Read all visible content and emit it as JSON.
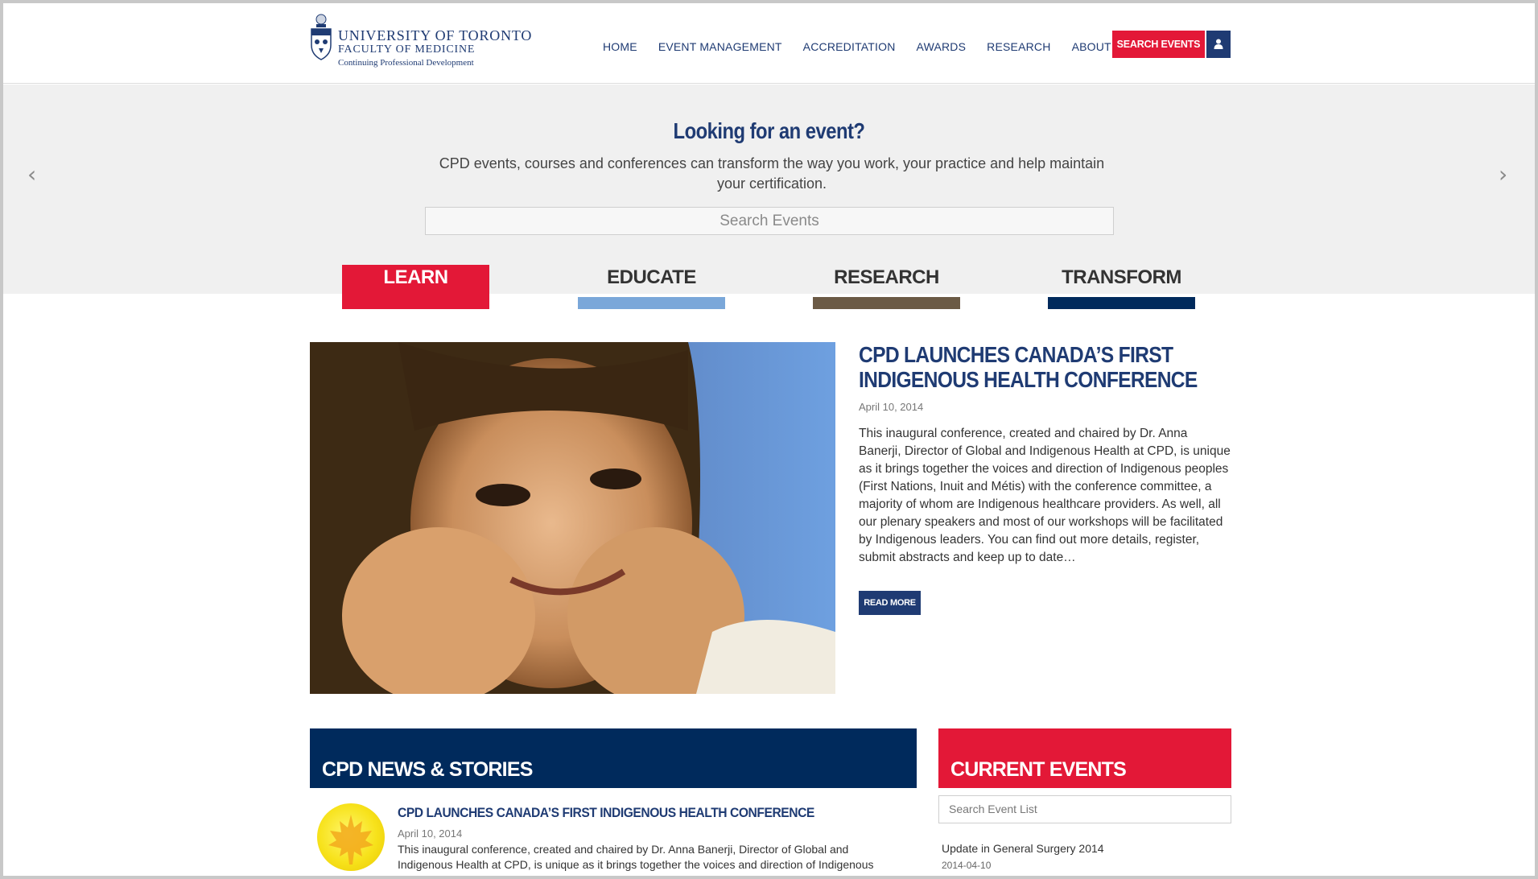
{
  "header": {
    "logo": {
      "line1": "UNIVERSITY OF TORONTO",
      "line2": "FACULTY OF MEDICINE",
      "line3": "Continuing Professional Development"
    },
    "nav": [
      {
        "label": "HOME"
      },
      {
        "label": "EVENT MANAGEMENT"
      },
      {
        "label": "ACCREDITATION"
      },
      {
        "label": "AWARDS"
      },
      {
        "label": "RESEARCH"
      },
      {
        "label": "ABOUT"
      }
    ],
    "search_button": "SEARCH EVENTS",
    "user_icon": "user-icon"
  },
  "hero": {
    "title": "Looking for an event?",
    "subtitle": "CPD events, courses and conferences can transform the way you work, your practice and help maintain your certification.",
    "search_placeholder": "Search Events",
    "prev_icon": "chevron-left-icon",
    "next_icon": "chevron-right-icon"
  },
  "tabs": [
    {
      "label": "LEARN",
      "color": "#e31837"
    },
    {
      "label": "EDUCATE",
      "color": "#7aa7d9"
    },
    {
      "label": "RESEARCH",
      "color": "#6b5a45"
    },
    {
      "label": "TRANSFORM",
      "color": "#002a5c"
    }
  ],
  "feature": {
    "title": "CPD LAUNCHES CANADA’S FIRST INDIGENOUS HEALTH CONFERENCE",
    "date": "April 10, 2014",
    "body": "This inaugural conference, created and chaired by Dr. Anna Banerji, Director of Global and Indigenous Health at CPD, is unique as it brings together the voices and direction of Indigenous peoples (First Nations, Inuit and Métis) with the conference committee, a majority of whom are Indigenous healthcare providers. As well, all our plenary speakers and most of our workshops will be facilitated by Indigenous leaders. You can find out more details, register, submit abstracts and keep up to date…",
    "read_more": "READ MORE"
  },
  "news": {
    "heading": "CPD NEWS & STORIES",
    "item": {
      "title": "CPD LAUNCHES CANADA’S FIRST INDIGENOUS HEALTH CONFERENCE",
      "date": "April 10, 2014",
      "body": "This inaugural conference, created and chaired by Dr. Anna Banerji, Director of Global and Indigenous Health at CPD, is unique as it brings together the voices and direction of Indigenous peoples (First Nations, Inuit and Métis) with the conference committee, a majority of whom are Indigenous"
    }
  },
  "events": {
    "heading": "CURRENT EVENTS",
    "search_placeholder": "Search Event List",
    "items": [
      {
        "title": "Update in General Surgery 2014",
        "date": "2014-04-10"
      }
    ]
  },
  "colors": {
    "navy": "#1f3b73",
    "dark_navy": "#002a5c",
    "red": "#e31837",
    "hero_bg": "#f0f0f0"
  }
}
